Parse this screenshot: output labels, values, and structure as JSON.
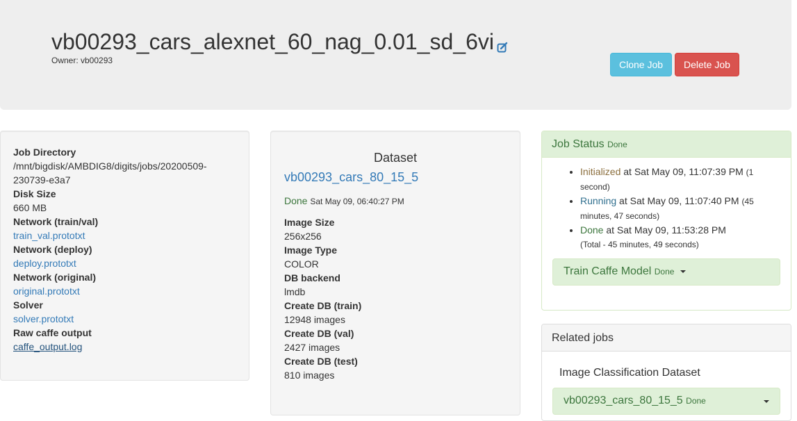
{
  "header": {
    "title": "vb00293_cars_alexnet_60_nag_0.01_sd_6vi",
    "owner": "Owner: vb00293",
    "clone_label": "Clone Job",
    "delete_label": "Delete Job"
  },
  "job_info": {
    "items": [
      {
        "label": "Job Directory",
        "value": "/mnt/bigdisk/AMBDIG8/digits/jobs/20200509-230739-e3a7"
      },
      {
        "label": "Disk Size",
        "value": "660 MB"
      },
      {
        "label": "Network (train/val)",
        "value": "train_val.prototxt"
      },
      {
        "label": "Network (deploy)",
        "value": "deploy.prototxt"
      },
      {
        "label": "Network (original)",
        "value": "original.prototxt"
      },
      {
        "label": "Solver",
        "value": "solver.prototxt"
      },
      {
        "label": "Raw caffe output",
        "value": "caffe_output.log"
      }
    ]
  },
  "dataset": {
    "heading": "Dataset",
    "name": "vb00293_cars_80_15_5",
    "status": "Done",
    "status_time": "Sat May 09, 06:40:27 PM",
    "items": [
      {
        "label": "Image Size",
        "value": "256x256"
      },
      {
        "label": "Image Type",
        "value": "COLOR"
      },
      {
        "label": "DB backend",
        "value": "lmdb"
      },
      {
        "label": "Create DB (train)",
        "value": "12948 images"
      },
      {
        "label": "Create DB (val)",
        "value": "2427 images"
      },
      {
        "label": "Create DB (test)",
        "value": "810 images"
      }
    ]
  },
  "job_status": {
    "title": "Job Status",
    "state": "Done",
    "entries": [
      {
        "state": "Initialized",
        "text": " at Sat May 09, 11:07:39 PM",
        "note": "(1 second)"
      },
      {
        "state": "Running",
        "text": " at Sat May 09, 11:07:40 PM",
        "note": "(45 minutes, 47 seconds)"
      },
      {
        "state": "Done",
        "text": " at Sat May 09, 11:53:28 PM",
        "note": "(Total - 45 minutes, 49 seconds)"
      }
    ],
    "train_task": "Train Caffe Model",
    "train_task_state": "Done"
  },
  "related": {
    "title": "Related jobs",
    "section": "Image Classification Dataset",
    "job_name": "vb00293_cars_80_15_5",
    "job_state": "Done"
  },
  "colors": {
    "header_bg": "#eeeeee",
    "info_button": "#5bc0de",
    "danger_button": "#d9534f",
    "success_bg": "#dff0d8",
    "success_text": "#3c763d",
    "link": "#337ab7"
  },
  "icons": {
    "edit": "edit-icon",
    "caret": "chevron-down-icon"
  }
}
